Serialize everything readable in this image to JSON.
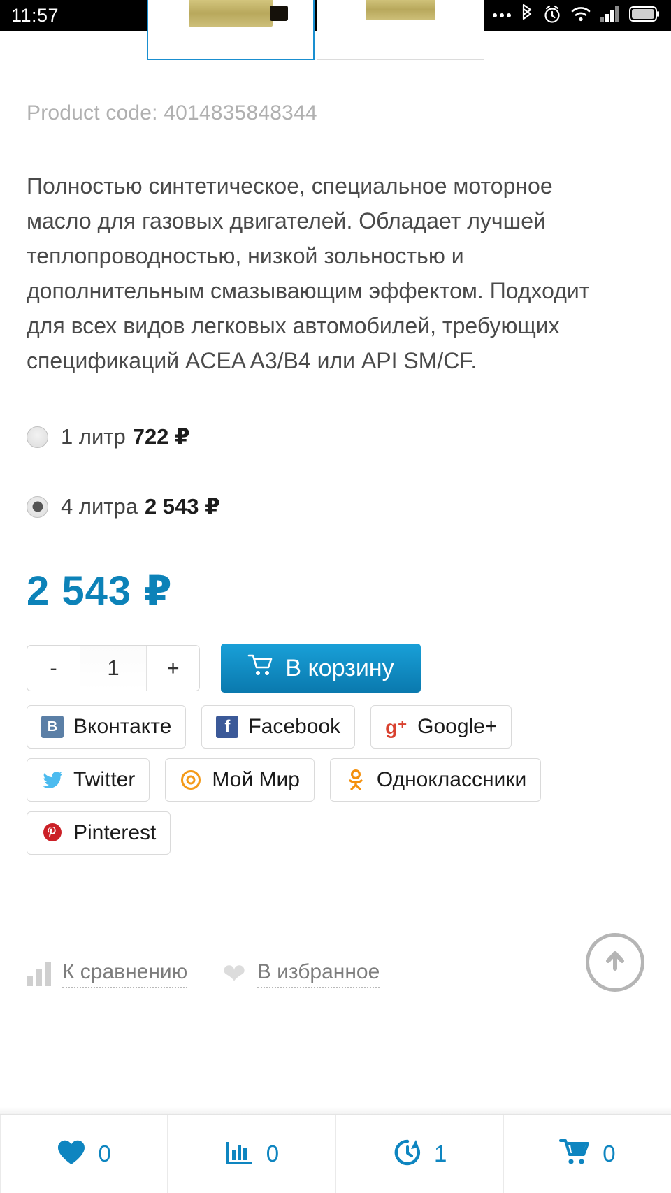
{
  "status_bar": {
    "time": "11:57",
    "icons": [
      "more-dots-icon",
      "bluetooth-icon",
      "alarm-icon",
      "wifi-icon",
      "signal-icon",
      "battery-icon"
    ]
  },
  "gallery": {
    "thumbs": [
      {
        "name": "thumbnail-1",
        "selected": true
      },
      {
        "name": "thumbnail-2",
        "selected": false
      }
    ],
    "selected_border_color": "#1a8fd0"
  },
  "product": {
    "code_label": "Product code: 4014835848344",
    "description": "Полностью синтетическое, специальное моторное масло для газовых двигателей. Обладает лучшей теплопроводностью, низкой зольностью и дополнительным смазывающим эффектом. Подходит для всех видов легковых автомобилей, требующих спецификаций ACEA A3/B4 или API SM/CF.",
    "options": [
      {
        "label": "1 литр",
        "price": "722 ₽",
        "selected": false
      },
      {
        "label": "4 литра",
        "price": "2 543 ₽",
        "selected": true
      }
    ],
    "price": "2 543 ₽",
    "price_color": "#0c82b8"
  },
  "purchase": {
    "minus_label": "-",
    "quantity": "1",
    "plus_label": "+",
    "add_to_cart_label": "В корзину",
    "cart_icon": "shopping-cart-icon",
    "button_color": "#0f8cc4"
  },
  "social": [
    {
      "name": "vkontakte",
      "label": "Вконтакте",
      "glyph": "В",
      "color": "#5b7fa6"
    },
    {
      "name": "facebook",
      "label": "Facebook",
      "glyph": "f",
      "color": "#3b5998"
    },
    {
      "name": "google-plus",
      "label": "Google+",
      "glyph": "g+",
      "color": "#d9412f"
    },
    {
      "name": "twitter",
      "label": "Twitter",
      "glyph": "🐦",
      "color": "#4cbbef"
    },
    {
      "name": "moy-mir",
      "label": "Мой Мир",
      "glyph": "@",
      "color": "#f49a18"
    },
    {
      "name": "odnoklassniki",
      "label": "Одноклассники",
      "glyph": "ok",
      "color": "#f4900c"
    },
    {
      "name": "pinterest",
      "label": "Pinterest",
      "glyph": "P",
      "color": "#cb2027"
    }
  ],
  "actions": {
    "compare_label": "К сравнению",
    "compare_icon": "bar-chart-icon",
    "favorite_label": "В избранное",
    "favorite_icon": "heart-icon",
    "scroll_top_icon": "arrow-up-icon"
  },
  "bottom_bar": [
    {
      "name": "favorites",
      "icon": "heart-icon",
      "count": "0"
    },
    {
      "name": "compare",
      "icon": "bar-chart-icon",
      "count": "0"
    },
    {
      "name": "history",
      "icon": "history-clock-icon",
      "count": "1"
    },
    {
      "name": "cart",
      "icon": "shopping-cart-icon",
      "count": "0"
    }
  ]
}
